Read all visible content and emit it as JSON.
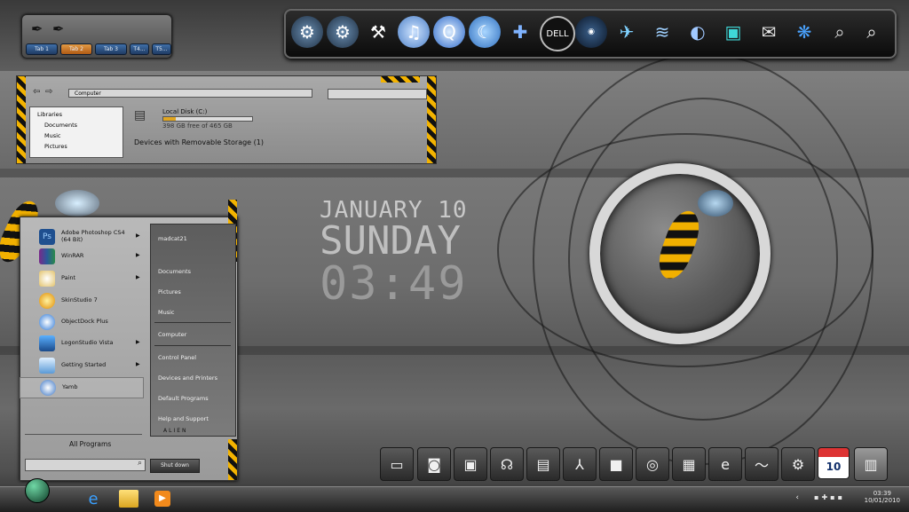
{
  "tabwidget": {
    "tabs": [
      "Tab 1",
      "Tab 2",
      "Tab 3",
      "T4...",
      "T5..."
    ],
    "active_tab": "Tab 2"
  },
  "topdock": {
    "icons": [
      "gear-icon",
      "gear-icon",
      "tools-icon",
      "music-icon",
      "quicktime-icon",
      "gimp-icon",
      "gamepad-icon",
      "dell-icon",
      "studio-icon",
      "aim-icon",
      "wave-icon",
      "browser-icon",
      "cube-icon",
      "mail-icon",
      "brain-icon",
      "magnifier-icon",
      "search-icon"
    ]
  },
  "explorer": {
    "address": "Computer",
    "nav_items": [
      "Libraries",
      "Documents",
      "Music",
      "Pictures"
    ],
    "drive_label": "Local Disk (C:)",
    "drive_free": "398 GB free of 465 GB",
    "drive_used_fraction": 0.14,
    "removable_group": "Devices with Removable Storage (1)"
  },
  "clock": {
    "date": "JANUARY 10",
    "day": "SUNDAY",
    "time": "03:49"
  },
  "startmenu": {
    "programs": [
      {
        "label": "Adobe Photoshop CS4 (64 Bit)",
        "icon": "photoshop-icon",
        "has_arrow": true
      },
      {
        "label": "WinRAR",
        "icon": "winrar-icon",
        "has_arrow": true
      },
      {
        "label": "Paint",
        "icon": "paint-icon",
        "has_arrow": true
      },
      {
        "label": "SkinStudio 7",
        "icon": "skinstudio-icon",
        "has_arrow": false
      },
      {
        "label": "ObjectDock Plus",
        "icon": "objectdock-icon",
        "has_arrow": false
      },
      {
        "label": "LogonStudio Vista",
        "icon": "logonstudio-icon",
        "has_arrow": true
      },
      {
        "label": "Getting Started",
        "icon": "getting-started-icon",
        "has_arrow": true
      },
      {
        "label": "Yamb",
        "icon": "yamb-icon",
        "has_arrow": false
      }
    ],
    "all_programs": "All Programs",
    "right_items": [
      "madcat21",
      "Documents",
      "Pictures",
      "Music",
      "Computer",
      "Control Panel",
      "Devices and Printers",
      "Default Programs",
      "Help and Support"
    ],
    "brand": "ALIEN",
    "shutdown": "Shut down"
  },
  "bottomdock": {
    "icons": [
      "monitor-icon",
      "camera-icon",
      "user-folder-icon",
      "headphones-icon",
      "clapper-icon",
      "recycle-arrows-icon",
      "video-camera-icon",
      "disc-icon",
      "calculator-icon",
      "ie-icon",
      "wave-icon",
      "gear-icon",
      "calendar-icon",
      "trash-icon"
    ],
    "calendar_day": "10"
  },
  "taskbar": {
    "pinned": [
      "ie-icon",
      "folder-icon",
      "media-player-icon"
    ],
    "clock_time": "03:39",
    "clock_date": "10/01/2010"
  }
}
